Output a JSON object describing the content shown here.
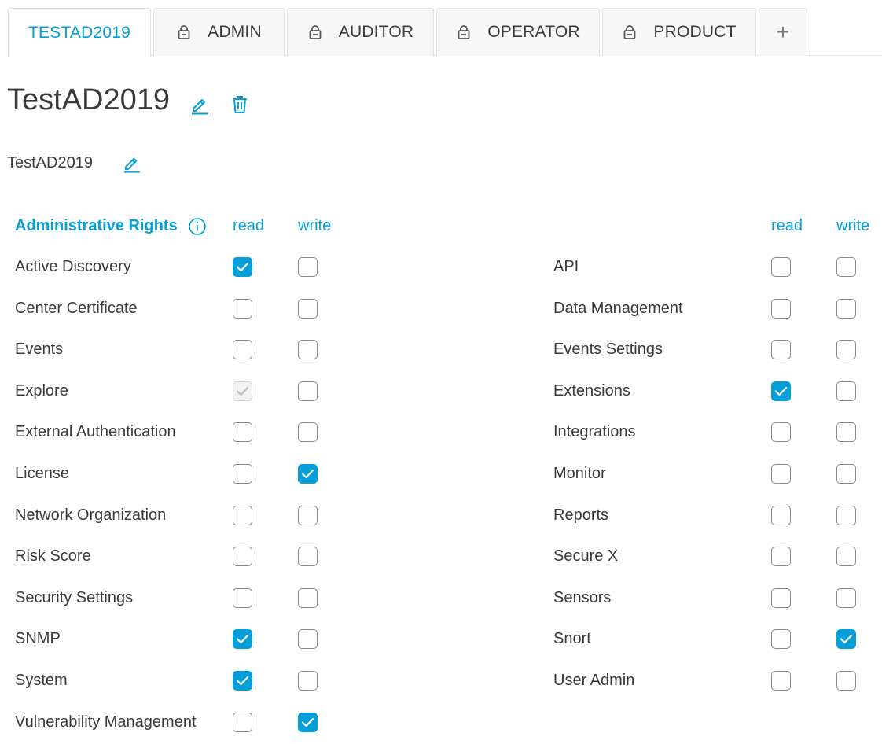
{
  "tabs": [
    {
      "label": "TESTAD2019",
      "active": true,
      "locked": false
    },
    {
      "label": "ADMIN",
      "active": false,
      "locked": true
    },
    {
      "label": "AUDITOR",
      "active": false,
      "locked": true
    },
    {
      "label": "OPERATOR",
      "active": false,
      "locked": true
    },
    {
      "label": "PRODUCT",
      "active": false,
      "locked": true
    }
  ],
  "add_tab_label": "+",
  "page": {
    "title": "TestAD2019",
    "subtitle": "TestAD2019"
  },
  "rights": {
    "header": "Administrative Rights",
    "read_label": "read",
    "write_label": "write",
    "left": [
      {
        "name": "Active Discovery",
        "read": "checked",
        "write": "unchecked"
      },
      {
        "name": "Center Certificate",
        "read": "unchecked",
        "write": "unchecked"
      },
      {
        "name": "Events",
        "read": "unchecked",
        "write": "unchecked"
      },
      {
        "name": "Explore",
        "read": "disabled-checked",
        "write": "unchecked"
      },
      {
        "name": "External Authentication",
        "read": "unchecked",
        "write": "unchecked"
      },
      {
        "name": "License",
        "read": "unchecked",
        "write": "checked"
      },
      {
        "name": "Network Organization",
        "read": "unchecked",
        "write": "unchecked"
      },
      {
        "name": "Risk Score",
        "read": "unchecked",
        "write": "unchecked"
      },
      {
        "name": "Security Settings",
        "read": "unchecked",
        "write": "unchecked"
      },
      {
        "name": "SNMP",
        "read": "checked",
        "write": "unchecked"
      },
      {
        "name": "System",
        "read": "checked",
        "write": "unchecked"
      },
      {
        "name": "Vulnerability Management",
        "read": "unchecked",
        "write": "checked"
      }
    ],
    "right": [
      {
        "name": "API",
        "read": "unchecked",
        "write": "unchecked"
      },
      {
        "name": "Data Management",
        "read": "unchecked",
        "write": "unchecked"
      },
      {
        "name": "Events Settings",
        "read": "unchecked",
        "write": "unchecked"
      },
      {
        "name": "Extensions",
        "read": "checked",
        "write": "unchecked"
      },
      {
        "name": "Integrations",
        "read": "unchecked",
        "write": "unchecked"
      },
      {
        "name": "Monitor",
        "read": "unchecked",
        "write": "unchecked"
      },
      {
        "name": "Reports",
        "read": "unchecked",
        "write": "unchecked"
      },
      {
        "name": "Secure X",
        "read": "unchecked",
        "write": "unchecked"
      },
      {
        "name": "Sensors",
        "read": "unchecked",
        "write": "unchecked"
      },
      {
        "name": "Snort",
        "read": "unchecked",
        "write": "checked"
      },
      {
        "name": "User Admin",
        "read": "unchecked",
        "write": "unchecked"
      }
    ]
  },
  "colors": {
    "accent": "#049fd9",
    "text": "#3a3a3a",
    "checkbox_border": "#8a8a8a"
  },
  "icons": {
    "tab_lock": "lock-icon",
    "title_edit": "pencil-icon",
    "title_delete": "trash-icon",
    "info": "info-icon",
    "add_tab": "plus-icon"
  }
}
